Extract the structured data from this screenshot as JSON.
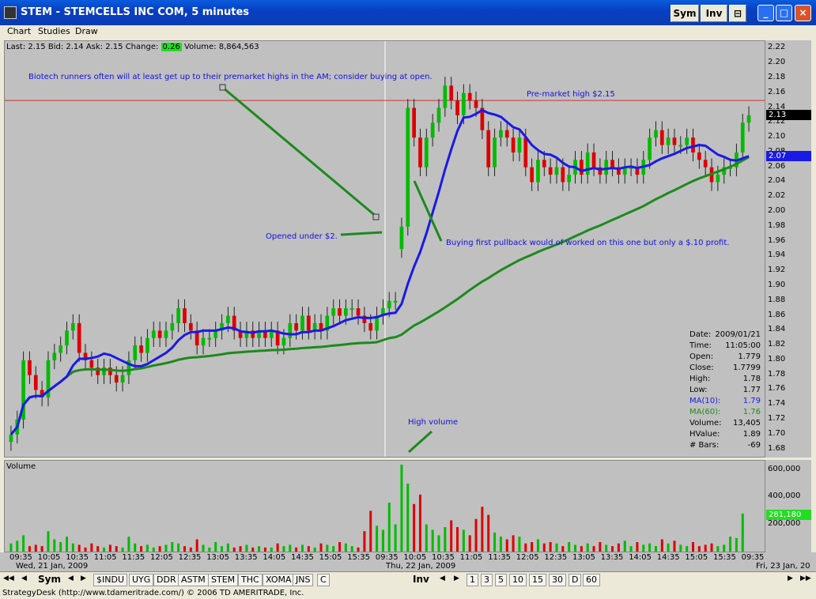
{
  "window": {
    "title": "STEM - STEMCELLS INC COM, 5 minutes",
    "sym_button": "Sym",
    "inv_button": "Inv",
    "minimize": "_",
    "maximize": "□",
    "close": "×"
  },
  "menu": [
    "Chart",
    "Studies",
    "Draw"
  ],
  "quote": {
    "last_label": "Last:",
    "last": "2.15",
    "bid_label": "Bid:",
    "bid": "2.14",
    "ask_label": "Ask:",
    "ask": "2.15",
    "change_label": "Change:",
    "change": "0.26",
    "volume_label": "Volume:",
    "volume": "8,864,563"
  },
  "colors": {
    "up": "#00bb00",
    "down": "#dd0000",
    "ma10": "#1a1ae6",
    "ma60": "#1c8a1c",
    "resistance": "#cc3333",
    "annotation_text": "#1010e0",
    "annotation_line": "#1c8a1c",
    "chart_bg": "#c0c0c0"
  },
  "annotations": {
    "biotech": "Biotech runners often will at least get up to their premarket highs in the AM; consider buying at open.",
    "premarket": "Pre-market high $2.15",
    "opened": "Opened under $2.",
    "pullback": "Buying first pullback would of worked on this one but only a $.10 profit.",
    "highvol": "High volume"
  },
  "price_badges": {
    "last": "2.13",
    "ma": "2.07"
  },
  "volume_badge": "281,180",
  "volume_title": "Volume",
  "info": {
    "date_label": "Date:",
    "date": "2009/01/21",
    "time_label": "Time:",
    "time": "11:05:00",
    "open_label": "Open:",
    "open": "1.779",
    "close_label": "Close:",
    "close": "1.7799",
    "high_label": "High:",
    "high": "1.78",
    "low_label": "Low:",
    "low": "1.77",
    "ma10_label": "MA(10):",
    "ma10": "1.79",
    "ma60_label": "MA(60):",
    "ma60": "1.76",
    "volume_label": "Volume:",
    "volume": "13,405",
    "hvalue_label": "HValue:",
    "hvalue": "1.89",
    "bars_label": "# Bars:",
    "bars": "-69"
  },
  "time_axis": {
    "times": [
      "09:35",
      "10:05",
      "10:35",
      "11:05",
      "11:35",
      "12:05",
      "12:35",
      "13:05",
      "13:35",
      "14:05",
      "14:35",
      "15:05",
      "15:35",
      "09:35",
      "10:05",
      "10:35",
      "11:05",
      "11:35",
      "12:05",
      "12:35",
      "13:05",
      "13:35",
      "14:05",
      "14:35",
      "15:05",
      "15:35",
      "09:35"
    ],
    "dates": [
      "Wed, 21 Jan, 2009",
      "Thu, 22 Jan, 2009",
      "Fri, 23 Jan, 20"
    ]
  },
  "tabs": {
    "sym_label": "Sym",
    "symbols": [
      "$INDU",
      "UYG",
      "DDR",
      "ASTM",
      "STEM",
      "THC",
      "XOMA",
      "JNS",
      "C"
    ],
    "inv_label": "Inv",
    "intervals": [
      "1",
      "3",
      "5",
      "10",
      "15",
      "30",
      "D",
      "60"
    ]
  },
  "status": "StrategyDesk (http://www.tdameritrade.com/) © 2006 TD AMERITRADE, Inc.",
  "chart_data": {
    "type": "candlestick",
    "ylim": [
      1.67,
      2.23
    ],
    "yticks": [
      "2.22",
      "2.20",
      "2.18",
      "2.16",
      "2.14",
      "2.12",
      "2.10",
      "2.08",
      "2.06",
      "2.04",
      "2.02",
      "2.00",
      "1.98",
      "1.96",
      "1.94",
      "1.92",
      "1.90",
      "1.88",
      "1.86",
      "1.84",
      "1.82",
      "1.80",
      "1.78",
      "1.76",
      "1.74",
      "1.72",
      "1.70",
      "1.68"
    ],
    "resistance": 2.15,
    "closes": [
      1.7,
      1.72,
      1.8,
      1.78,
      1.76,
      1.75,
      1.8,
      1.81,
      1.82,
      1.84,
      1.85,
      1.81,
      1.8,
      1.79,
      1.78,
      1.79,
      1.78,
      1.77,
      1.78,
      1.8,
      1.82,
      1.81,
      1.83,
      1.84,
      1.83,
      1.84,
      1.85,
      1.87,
      1.85,
      1.84,
      1.82,
      1.83,
      1.83,
      1.84,
      1.85,
      1.86,
      1.84,
      1.83,
      1.84,
      1.83,
      1.84,
      1.83,
      1.84,
      1.82,
      1.83,
      1.85,
      1.84,
      1.86,
      1.84,
      1.85,
      1.84,
      1.86,
      1.87,
      1.86,
      1.87,
      1.87,
      1.86,
      1.85,
      1.84,
      1.86,
      1.87,
      1.88,
      1.88,
      1.98,
      2.14,
      2.1,
      2.06,
      2.1,
      2.12,
      2.14,
      2.17,
      2.15,
      2.13,
      2.16,
      2.15,
      2.14,
      2.11,
      2.06,
      2.1,
      2.11,
      2.1,
      2.08,
      2.1,
      2.06,
      2.04,
      2.07,
      2.06,
      2.05,
      2.06,
      2.04,
      2.05,
      2.07,
      2.05,
      2.08,
      2.06,
      2.05,
      2.07,
      2.06,
      2.05,
      2.06,
      2.06,
      2.05,
      2.07,
      2.1,
      2.11,
      2.09,
      2.1,
      2.09,
      2.09,
      2.1,
      2.08,
      2.07,
      2.06,
      2.04,
      2.05,
      2.06,
      2.06,
      2.08,
      2.12,
      2.13
    ],
    "volume_ylim": [
      0,
      640000
    ],
    "volume_ticks": [
      "600,000",
      "400,000",
      "200,000"
    ],
    "volumes": [
      60000,
      80000,
      120000,
      40000,
      50000,
      40000,
      150000,
      90000,
      70000,
      110000,
      60000,
      50000,
      30000,
      60000,
      40000,
      30000,
      50000,
      40000,
      30000,
      110000,
      60000,
      40000,
      50000,
      30000,
      40000,
      50000,
      70000,
      60000,
      40000,
      30000,
      90000,
      50000,
      30000,
      70000,
      40000,
      60000,
      30000,
      40000,
      50000,
      30000,
      40000,
      30000,
      30000,
      60000,
      40000,
      50000,
      30000,
      50000,
      40000,
      30000,
      60000,
      50000,
      40000,
      70000,
      60000,
      40000,
      30000,
      150000,
      300000,
      190000,
      160000,
      360000,
      200000,
      640000,
      500000,
      350000,
      420000,
      200000,
      160000,
      120000,
      180000,
      230000,
      180000,
      160000,
      120000,
      240000,
      330000,
      270000,
      140000,
      110000,
      90000,
      120000,
      110000,
      60000,
      70000,
      90000,
      60000,
      70000,
      60000,
      40000,
      70000,
      50000,
      40000,
      60000,
      40000,
      70000,
      50000,
      40000,
      60000,
      80000,
      40000,
      70000,
      50000,
      60000,
      40000,
      90000,
      60000,
      80000,
      50000,
      40000,
      70000,
      40000,
      50000,
      60000,
      40000,
      50000,
      110000,
      100000,
      280000
    ]
  }
}
